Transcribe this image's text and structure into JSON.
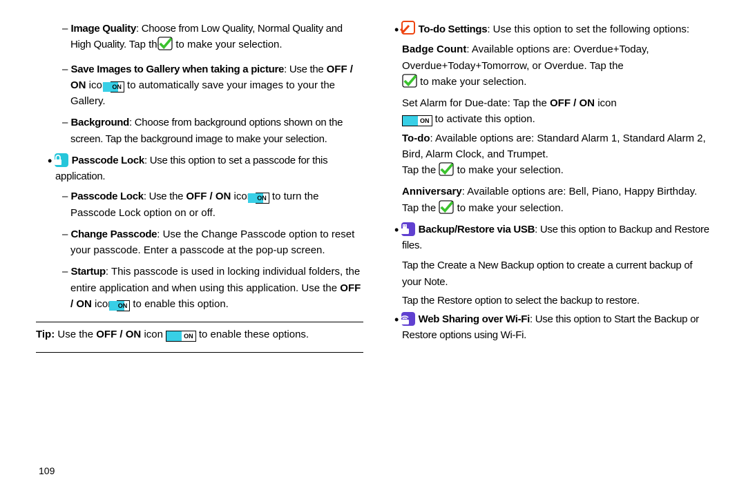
{
  "left": {
    "imgq_label": "Image Quality",
    "imgq_text1": ": Choose from Low Quality, Normal Quality and High Quality.",
    "imgq_tap": "Tap the",
    "imgq_text2": "to make your selection.",
    "save_label": "Save Images to Gallery when taking a picture",
    "save_t1": ": Use the",
    "save_offon": "OFF / ON",
    "save_t2": "icon",
    "save_t3": "to automatically save your images to your the Gallery.",
    "bg_label": "Background",
    "bg_text": ": Choose from background options shown on the screen. Tap the background image to make your selection.",
    "pl_label": "Passcode Lock",
    "pl_text": ": Use this option to set a passcode for this application.",
    "pl2_label": "Passcode Lock",
    "pl2_t1": ": Use the",
    "pl2_offon": "OFF / ON",
    "pl2_t2": "icon",
    "pl2_t3": "to turn the Passcode Lock option on or off.",
    "cp_label": "Change Passcode",
    "cp_text": ": Use the Change Passcode option to reset your passcode. Enter a passcode at the pop-up screen.",
    "st_label": "Startup",
    "st_t1": ": This passcode is used in locking individual folders, the entire application and when using this application.",
    "st_use": "Use the",
    "st_offon": "OFF / ON",
    "st_t2": "icon",
    "st_t3": "to enable this option.",
    "tip_b": "Tip:",
    "tip_t1": "Use the",
    "tip_offon": "OFF / ON",
    "tip_t2": "icon",
    "tip_t3": "to enable these options."
  },
  "right": {
    "todo_label": "To-do Settings",
    "todo_t1": ": Use this option to set the following options:",
    "bc_label": "Badge Count",
    "bc_t1": ": Available options are: Overdue+Today, Overdue+Today+Tomorrow, or Overdue.",
    "bc_tap": "Tap the",
    "bc_t2": "to make your selection.",
    "sa_t1": "Set Alarm for Due-date: Tap the",
    "sa_offon": "OFF / ON",
    "sa_t2": "icon",
    "sa_t3": "to activate this option.",
    "td_label": "To-do",
    "td_t1": ": Available options are: Standard Alarm 1, Standard Alarm 2, Bird, Alarm Clock, and Trumpet.",
    "td_tap": "Tap the",
    "td_t2": "to make your selection.",
    "an_label": "Anniversary",
    "an_t1": ": Available options are: Bell, Piano, Happy Birthday.",
    "an_tap": "Tap the",
    "an_t2": "to make your selection.",
    "bu_label": "Backup/Restore via USB",
    "bu_t1": ": Use this option to Backup and Restore files.",
    "bu_t2": "Tap the Create a New Backup option to create a current backup of your Note.",
    "bu_t3": "Tap the Restore option to select the backup to restore.",
    "ws_label": "Web Sharing over Wi-Fi",
    "ws_t1": ": Use this option to Start the Backup or Restore options using Wi-Fi."
  },
  "on_label": "ON",
  "page_num": "109"
}
